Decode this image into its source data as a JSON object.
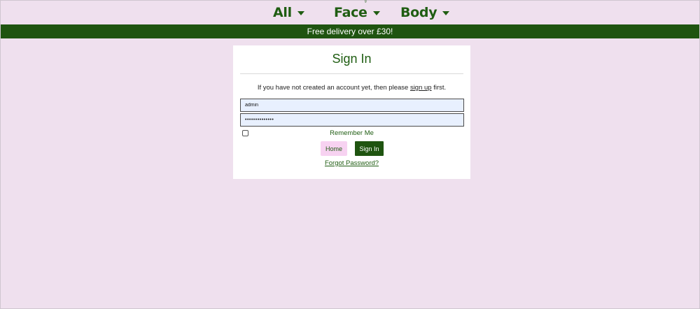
{
  "nav": {
    "items": [
      {
        "label": "All"
      },
      {
        "label": "Face"
      },
      {
        "label": "Body"
      }
    ]
  },
  "banner": {
    "text": "Free delivery over £30!"
  },
  "signin": {
    "title": "Sign In",
    "intro_prefix": "If you have not created an account yet, then please",
    "signup_link": "sign up",
    "intro_suffix": "first.",
    "username_value": "admin",
    "password_value": "••••••••••••••",
    "remember_label": "Remember Me",
    "remember_checked": false,
    "home_button": "Home",
    "signin_button": "Sign In",
    "forgot_link": "Forgot Password?"
  },
  "colors": {
    "accent": "#1f5410",
    "background": "#efe0ee",
    "home_button_bg": "#f7d2f1"
  }
}
